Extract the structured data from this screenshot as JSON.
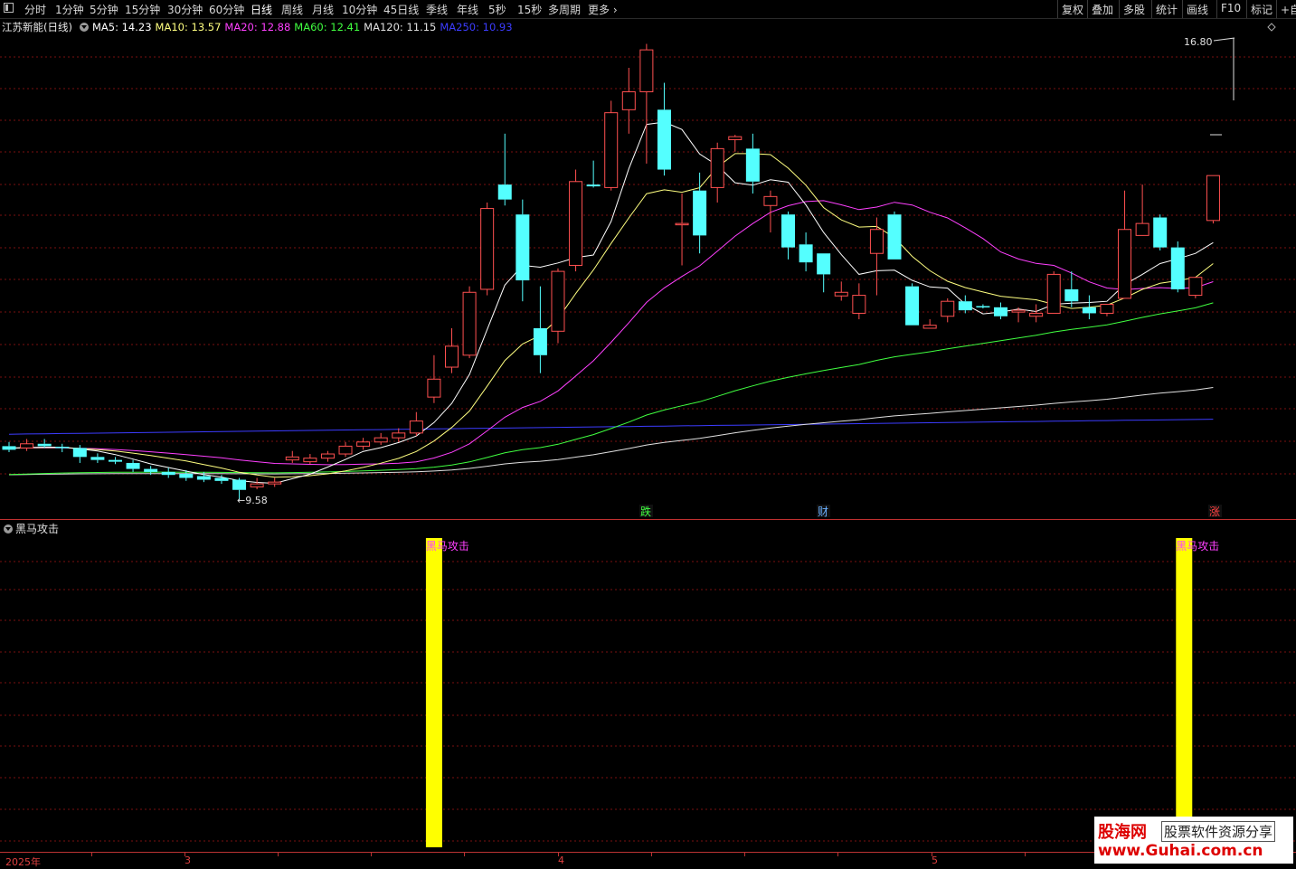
{
  "toolbar": {
    "periods": [
      "分时",
      "1分钟",
      "5分钟",
      "15分钟",
      "30分钟",
      "60分钟",
      "日线",
      "周线",
      "月线",
      "10分钟",
      "45日线",
      "季线",
      "年线",
      "5秒",
      "15秒",
      "多周期",
      "更多"
    ],
    "active_period": "日线",
    "right_buttons": [
      "复权",
      "叠加",
      "多股",
      "统计",
      "画线",
      "F10",
      "标记",
      "+自"
    ]
  },
  "stock": {
    "name": "江苏新能(日线)"
  },
  "ma": [
    {
      "label": "MA5: 14.23",
      "color": "#ffffff"
    },
    {
      "label": "MA10: 13.57",
      "color": "#ffff80"
    },
    {
      "label": "MA20: 12.88",
      "color": "#ff40ff"
    },
    {
      "label": "MA60: 12.41",
      "color": "#40ff40"
    },
    {
      "label": "MA120: 11.15",
      "color": "#e0e0e0"
    },
    {
      "label": "MA250: 10.93",
      "color": "#3c3cff"
    }
  ],
  "price_marks": {
    "high": "16.80",
    "low": "←9.58"
  },
  "events": [
    "跌",
    "财",
    "涨"
  ],
  "indicator": {
    "title": "黑马攻击",
    "signal_label": "黑马攻击"
  },
  "xaxis": {
    "labels": [
      "2025年",
      "3",
      "4",
      "5"
    ]
  },
  "watermark": {
    "cn": "股海网",
    "tag": "股票软件资源分享",
    "url": "www.Guhai.com.cn"
  },
  "colors": {
    "up": "#ff5050",
    "down": "#54ffff",
    "grid": "#8b1a1a",
    "signal": "#ffff00"
  },
  "chart_data": {
    "type": "candlestick",
    "price_range": [
      9.3,
      17.2
    ],
    "candles": [
      [
        10.48,
        10.42,
        10.55,
        10.38
      ],
      [
        10.45,
        10.52,
        10.6,
        10.4
      ],
      [
        10.52,
        10.48,
        10.6,
        10.45
      ],
      [
        10.47,
        10.45,
        10.52,
        10.38
      ],
      [
        10.45,
        10.3,
        10.5,
        10.2
      ],
      [
        10.3,
        10.25,
        10.36,
        10.2
      ],
      [
        10.25,
        10.22,
        10.3,
        10.18
      ],
      [
        10.2,
        10.1,
        10.25,
        10.05
      ],
      [
        10.1,
        10.05,
        10.15,
        10.0
      ],
      [
        10.05,
        10.0,
        10.12,
        9.95
      ],
      [
        10.02,
        9.95,
        10.08,
        9.9
      ],
      [
        9.98,
        9.92,
        10.05,
        9.88
      ],
      [
        9.95,
        9.9,
        10.0,
        9.85
      ],
      [
        9.92,
        9.75,
        9.95,
        9.58
      ],
      [
        9.8,
        9.85,
        9.95,
        9.76
      ],
      [
        9.85,
        9.88,
        9.95,
        9.8
      ],
      [
        10.25,
        10.3,
        10.4,
        10.2
      ],
      [
        10.22,
        10.28,
        10.35,
        10.18
      ],
      [
        10.28,
        10.35,
        10.4,
        10.22
      ],
      [
        10.35,
        10.48,
        10.55,
        10.3
      ],
      [
        10.48,
        10.55,
        10.62,
        10.42
      ],
      [
        10.55,
        10.62,
        10.7,
        10.5
      ],
      [
        10.62,
        10.7,
        10.78,
        10.55
      ],
      [
        10.7,
        10.9,
        11.05,
        10.65
      ],
      [
        11.3,
        11.6,
        12.0,
        11.2
      ],
      [
        11.8,
        12.15,
        12.45,
        11.7
      ],
      [
        12.0,
        13.05,
        13.15,
        11.95
      ],
      [
        13.1,
        14.45,
        14.55,
        13.0
      ],
      [
        14.85,
        14.6,
        15.7,
        14.5
      ],
      [
        14.35,
        13.25,
        14.6,
        12.9
      ],
      [
        12.45,
        12.0,
        13.15,
        11.7
      ],
      [
        12.4,
        13.4,
        13.45,
        12.2
      ],
      [
        13.5,
        14.9,
        15.1,
        13.4
      ],
      [
        14.85,
        14.82,
        15.25,
        14.8
      ],
      [
        14.8,
        16.05,
        16.25,
        14.75
      ],
      [
        16.1,
        16.4,
        16.8,
        15.7
      ],
      [
        16.4,
        17.1,
        17.2,
        15.2
      ],
      [
        16.1,
        15.1,
        16.55,
        15.0
      ],
      [
        14.2,
        14.2,
        14.7,
        13.5
      ],
      [
        14.75,
        14.0,
        15.05,
        13.7
      ],
      [
        14.8,
        15.45,
        15.55,
        14.55
      ],
      [
        15.6,
        15.65,
        15.68,
        15.4
      ],
      [
        15.45,
        14.9,
        15.7,
        14.7
      ],
      [
        14.5,
        14.65,
        14.75,
        14.05
      ],
      [
        14.35,
        13.8,
        14.4,
        13.6
      ],
      [
        13.85,
        13.55,
        14.05,
        13.4
      ],
      [
        13.7,
        13.35,
        13.7,
        13.05
      ],
      [
        12.99,
        13.05,
        13.23,
        12.91
      ],
      [
        12.7,
        13.0,
        13.2,
        12.6
      ],
      [
        13.7,
        14.1,
        14.3,
        13.0
      ],
      [
        14.35,
        13.6,
        14.4,
        13.6
      ],
      [
        13.15,
        12.5,
        13.2,
        12.5
      ],
      [
        12.45,
        12.5,
        12.6,
        12.45
      ],
      [
        12.65,
        12.9,
        12.95,
        12.55
      ],
      [
        12.9,
        12.75,
        13.0,
        12.7
      ],
      [
        12.82,
        12.8,
        12.85,
        12.78
      ],
      [
        12.8,
        12.65,
        12.88,
        12.6
      ],
      [
        12.72,
        12.75,
        12.8,
        12.55
      ],
      [
        12.65,
        12.7,
        12.85,
        12.55
      ],
      [
        12.7,
        13.35,
        13.4,
        12.7
      ],
      [
        13.1,
        12.9,
        13.4,
        12.8
      ],
      [
        12.8,
        12.7,
        13.0,
        12.6
      ],
      [
        12.7,
        12.85,
        12.85,
        12.65
      ],
      [
        12.95,
        14.1,
        14.75,
        12.95
      ],
      [
        14.0,
        14.2,
        14.85,
        14.0
      ],
      [
        14.3,
        13.8,
        14.35,
        13.75
      ],
      [
        13.8,
        13.1,
        13.9,
        13.05
      ],
      [
        13.0,
        13.3,
        13.3,
        12.95
      ],
      [
        14.25,
        15.0,
        15.0,
        14.2
      ]
    ],
    "signals_at": [
      24,
      66
    ]
  }
}
